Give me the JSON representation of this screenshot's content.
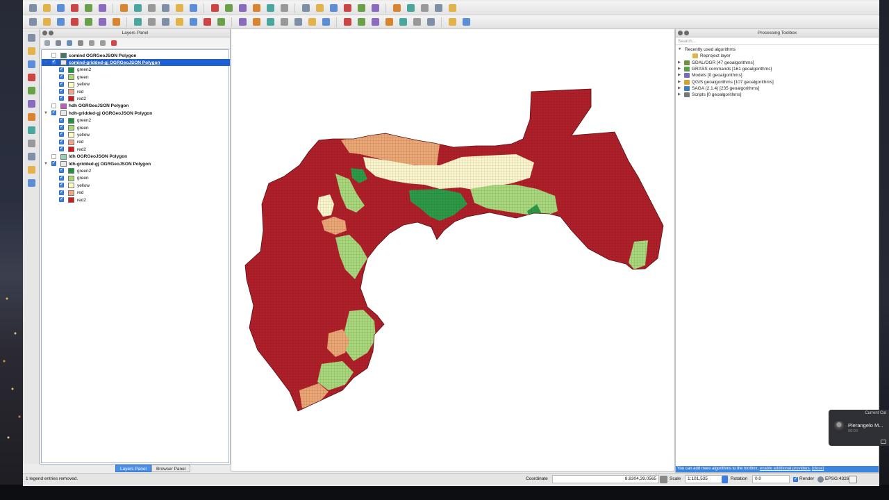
{
  "toolbar_row1": [
    "new-project-icon",
    "open-project-icon",
    "save-project-icon",
    "save-as-icon",
    "new-print-composer-icon",
    "composer-manager-icon",
    "pan-icon",
    "pan-to-selection-icon",
    "zoom-in-icon",
    "zoom-out-icon",
    "zoom-native-icon",
    "zoom-full-icon",
    "zoom-to-selection-icon",
    "zoom-to-layer-icon",
    "zoom-last-icon",
    "zoom-next-icon",
    "refresh-icon",
    "identify-icon",
    "action-icon",
    "select-icon",
    "deselect-icon",
    "open-attribute-table-icon",
    "field-calculator-icon",
    "statistics-icon",
    "measure-icon",
    "annotation-icon",
    "label-icon",
    "text-annotation-icon",
    "help-icon"
  ],
  "toolbar_row2": [
    "toggle-edit-icon",
    "pencil-icon",
    "save-edits-icon",
    "add-feature-icon",
    "move-feature-icon",
    "node-tool-icon",
    "delete-selected-icon",
    "cut-icon",
    "copy-icon",
    "paste-icon",
    "label-pin-icon",
    "label-show-icon",
    "label-move-icon",
    "label-rotate-icon",
    "label-change-icon",
    "label-style-icon",
    "label-highlight-icon",
    "raster-calc-icon",
    "csw-icon",
    "python-icon",
    "ext-icon",
    "globe-icon",
    "refresh-plugin-icon",
    "plugin-a-icon",
    "plugin-b-icon",
    "plugin-c-icon",
    "plugin-d-icon",
    "plugin-e-icon",
    "plugin-f-icon",
    "plugin-g-icon"
  ],
  "vertical_tools": [
    "add-vector-layer-icon",
    "add-raster-layer-icon",
    "add-postgis-icon",
    "add-spatialite-icon",
    "add-mssql-icon",
    "add-oracle-icon",
    "add-wms-icon",
    "add-wcs-icon",
    "add-wfs-icon",
    "add-delimited-text-icon",
    "new-shapefile-icon",
    "add-virtual-layer-icon"
  ],
  "layers_panel": {
    "title": "Layers Panel",
    "layers": [
      {
        "name": "comind OGRGeoJSON Polygon",
        "checked": false,
        "expanded": false,
        "selected": false,
        "swatch": "#3d7a63"
      },
      {
        "name": "comind-gridded-gj OGRGeoJSON Polygon",
        "checked": true,
        "expanded": true,
        "selected": true,
        "swatch": "#e8e8e8",
        "classes": [
          {
            "label": "green2",
            "color": "#1a9641"
          },
          {
            "label": "green",
            "color": "#a6d96a"
          },
          {
            "label": "yellow",
            "color": "#ffffc0"
          },
          {
            "label": "red",
            "color": "#f4a582"
          },
          {
            "label": "red2",
            "color": "#d7191c"
          }
        ]
      },
      {
        "name": "hdh OGRGeoJSON Polygon",
        "checked": false,
        "expanded": false,
        "selected": false,
        "swatch": "#c25bc0"
      },
      {
        "name": "hdh-gridded-gj OGRGeoJSON Polygon",
        "checked": true,
        "expanded": true,
        "selected": false,
        "swatch": "#e8e8e8",
        "classes": [
          {
            "label": "green2",
            "color": "#1a9641"
          },
          {
            "label": "green",
            "color": "#a6d96a"
          },
          {
            "label": "yellow",
            "color": "#ffffc0"
          },
          {
            "label": "red",
            "color": "#f4a582"
          },
          {
            "label": "red2",
            "color": "#d7191c"
          }
        ]
      },
      {
        "name": "ldh OGRGeoJSON Polygon",
        "checked": false,
        "expanded": false,
        "selected": false,
        "swatch": "#8fd3b0"
      },
      {
        "name": "ldh-gridded-gj OGRGeoJSON Polygon",
        "checked": true,
        "expanded": true,
        "selected": false,
        "swatch": "#e8e8e8",
        "classes": [
          {
            "label": "green2",
            "color": "#1a9641"
          },
          {
            "label": "green",
            "color": "#a6d96a"
          },
          {
            "label": "yellow",
            "color": "#ffffc0"
          },
          {
            "label": "red",
            "color": "#f4a582"
          },
          {
            "label": "red2",
            "color": "#d7191c"
          }
        ]
      }
    ],
    "tabs": [
      "Layers Panel",
      "Browser Panel"
    ],
    "active_tab": "Layers Panel"
  },
  "map": {
    "colors": {
      "green2": "#2e9a48",
      "green": "#a8d77c",
      "yellow": "#fbf6cc",
      "red": "#eaa674",
      "red2": "#b0202a"
    }
  },
  "toolbox": {
    "title": "Processing Toolbox",
    "search_placeholder": "Search...",
    "tree": [
      {
        "label": "Recently used algorithms",
        "level": 0,
        "expanded": true,
        "icon": ""
      },
      {
        "label": "Reproject layer",
        "level": 1,
        "expanded": false,
        "icon": "reproject-icon"
      },
      {
        "label": "GDAL/OGR [47 geoalgorithms]",
        "level": 0,
        "expanded": false,
        "icon": "gdal-icon"
      },
      {
        "label": "GRASS commands [161 geoalgorithms]",
        "level": 0,
        "expanded": false,
        "icon": "grass-icon"
      },
      {
        "label": "Models [0 geoalgorithms]",
        "level": 0,
        "expanded": false,
        "icon": "models-icon"
      },
      {
        "label": "QGIS geoalgorithms [107 geoalgorithms]",
        "level": 0,
        "expanded": false,
        "icon": "qgis-icon"
      },
      {
        "label": "SAGA (2.1.4) [235 geoalgorithms]",
        "level": 0,
        "expanded": false,
        "icon": "saga-icon"
      },
      {
        "label": "Scripts [0 geoalgorithms]",
        "level": 0,
        "expanded": false,
        "icon": "scripts-icon"
      }
    ],
    "note_text": "You can add more algorithms to the toolbox,",
    "note_link": "enable additional providers.",
    "note_close": "[close]"
  },
  "statusbar": {
    "message": "1 legend entries removed.",
    "coordinate_label": "Coordinate",
    "coordinate_value": "8.8304,39.0565",
    "scale_label": "Scale",
    "scale_value": "1:101,535",
    "rotation_label": "Rotation",
    "rotation_value": "0.0",
    "render_label": "Render",
    "render_checked": true,
    "crs": "EPSG:4326"
  },
  "call_widget": {
    "title": "Current Cal",
    "name": "Pierangelo M...",
    "subtitle": "00:00"
  }
}
